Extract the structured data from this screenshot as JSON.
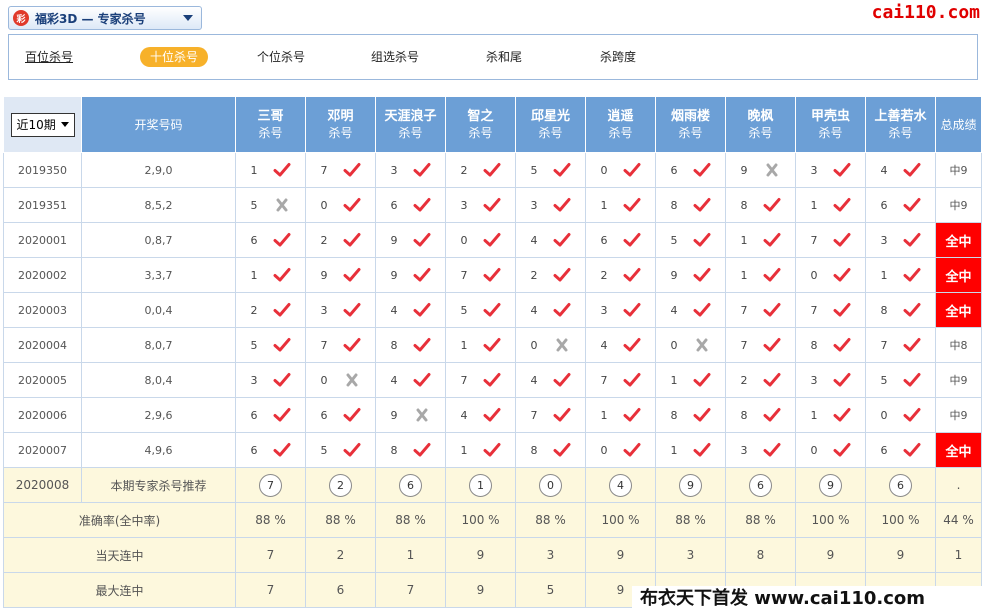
{
  "header": {
    "lottery": "福彩3D — 专家杀号",
    "logo_text": "彩",
    "brand": "cai110.com"
  },
  "tabs": [
    "百位杀号",
    "十位杀号",
    "个位杀号",
    "组选杀号",
    "杀和尾",
    "杀跨度"
  ],
  "active_tab": 1,
  "table": {
    "period_select": "近10期",
    "col_draw": "开奖号码",
    "col_total": "总成绩",
    "kill_suffix": "杀号",
    "experts": [
      "三哥",
      "邓明",
      "天涯浪子",
      "智之",
      "邱星光",
      "逍遥",
      "烟雨楼",
      "晚枫",
      "甲壳虫",
      "上善若水"
    ],
    "rows": [
      {
        "issue": "2019350",
        "draw": "2,9,0",
        "picks": [
          1,
          7,
          3,
          2,
          5,
          0,
          6,
          9,
          3,
          4
        ],
        "hits": [
          1,
          1,
          1,
          1,
          1,
          1,
          1,
          0,
          1,
          1
        ],
        "total": "中9",
        "full": false
      },
      {
        "issue": "2019351",
        "draw": "8,5,2",
        "picks": [
          5,
          0,
          6,
          3,
          3,
          1,
          8,
          8,
          1,
          6
        ],
        "hits": [
          0,
          1,
          1,
          1,
          1,
          1,
          1,
          1,
          1,
          1
        ],
        "total": "中9",
        "full": false
      },
      {
        "issue": "2020001",
        "draw": "0,8,7",
        "picks": [
          6,
          2,
          9,
          0,
          4,
          6,
          5,
          1,
          7,
          3
        ],
        "hits": [
          1,
          1,
          1,
          1,
          1,
          1,
          1,
          1,
          1,
          1
        ],
        "total": "全中",
        "full": true
      },
      {
        "issue": "2020002",
        "draw": "3,3,7",
        "picks": [
          1,
          9,
          9,
          7,
          2,
          2,
          9,
          1,
          0,
          1
        ],
        "hits": [
          1,
          1,
          1,
          1,
          1,
          1,
          1,
          1,
          1,
          1
        ],
        "total": "全中",
        "full": true
      },
      {
        "issue": "2020003",
        "draw": "0,0,4",
        "picks": [
          2,
          3,
          4,
          5,
          4,
          3,
          4,
          7,
          7,
          8
        ],
        "hits": [
          1,
          1,
          1,
          1,
          1,
          1,
          1,
          1,
          1,
          1
        ],
        "total": "全中",
        "full": true
      },
      {
        "issue": "2020004",
        "draw": "8,0,7",
        "picks": [
          5,
          7,
          8,
          1,
          0,
          4,
          0,
          7,
          8,
          7
        ],
        "hits": [
          1,
          1,
          1,
          1,
          0,
          1,
          0,
          1,
          1,
          1
        ],
        "total": "中8",
        "full": false
      },
      {
        "issue": "2020005",
        "draw": "8,0,4",
        "picks": [
          3,
          0,
          4,
          7,
          4,
          7,
          1,
          2,
          3,
          5
        ],
        "hits": [
          1,
          0,
          1,
          1,
          1,
          1,
          1,
          1,
          1,
          1
        ],
        "total": "中9",
        "full": false
      },
      {
        "issue": "2020006",
        "draw": "2,9,6",
        "picks": [
          6,
          6,
          9,
          4,
          7,
          1,
          8,
          8,
          1,
          0
        ],
        "hits": [
          1,
          1,
          0,
          1,
          1,
          1,
          1,
          1,
          1,
          1
        ],
        "total": "中9",
        "full": false
      },
      {
        "issue": "2020007",
        "draw": "4,9,6",
        "picks": [
          6,
          5,
          8,
          1,
          8,
          0,
          1,
          3,
          0,
          6
        ],
        "hits": [
          1,
          1,
          1,
          1,
          1,
          1,
          1,
          1,
          1,
          1
        ],
        "total": "全中",
        "full": true
      }
    ],
    "recommend": {
      "issue": "2020008",
      "label": "本期专家杀号推荐",
      "picks": [
        7,
        2,
        6,
        1,
        0,
        4,
        9,
        6,
        9,
        6
      ],
      "total": "."
    },
    "accuracy": {
      "label": "准确率(全中率)",
      "values": [
        "88 %",
        "88 %",
        "88 %",
        "100 %",
        "88 %",
        "100 %",
        "88 %",
        "88 %",
        "100 %",
        "100 %"
      ],
      "total": "44 %"
    },
    "current_streak": {
      "label": "当天连中",
      "values": [
        "7",
        "2",
        "1",
        "9",
        "3",
        "9",
        "3",
        "8",
        "9",
        "9"
      ],
      "total": "1"
    },
    "max_streak": {
      "label": "最大连中",
      "values": [
        "7",
        "6",
        "7",
        "9",
        "5",
        "9",
        "",
        "",
        "",
        ""
      ],
      "total": ""
    }
  },
  "watermark": "布衣天下首发 www.cai110.com",
  "colors": {
    "header_blue": "#6c9fd6",
    "hit_red": "#e8303a",
    "miss_gray": "#a8a8a8",
    "full_red": "#ff0000",
    "active_tab": "#f7b12a",
    "yellow_row": "#fdf8dd"
  }
}
